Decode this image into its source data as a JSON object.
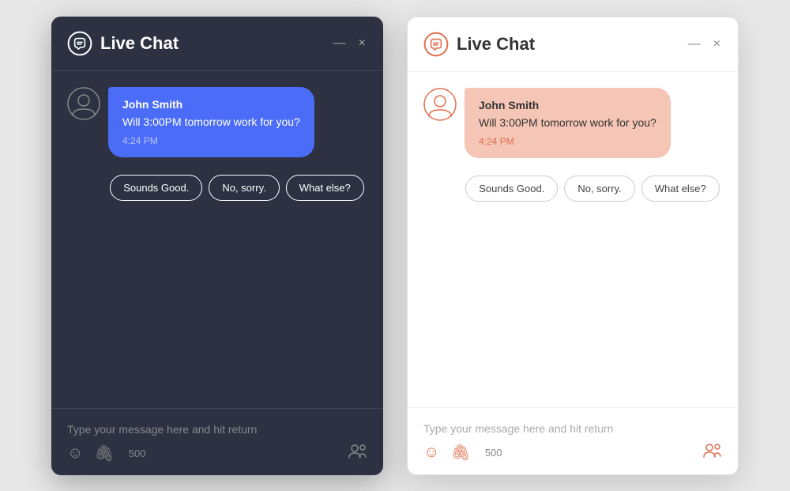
{
  "dark_widget": {
    "title": "Live Chat",
    "minimize_label": "—",
    "close_label": "×",
    "message": {
      "sender": "John Smith",
      "text": "Will 3:00PM tomorrow work for you?",
      "time": "4:24 PM"
    },
    "quick_replies": [
      "Sounds Good.",
      "No, sorry.",
      "What else?"
    ],
    "input_placeholder": "Type your message here and hit return",
    "char_count": "500"
  },
  "light_widget": {
    "title": "Live Chat",
    "minimize_label": "—",
    "close_label": "×",
    "message": {
      "sender": "John Smith",
      "text": "Will 3:00PM tomorrow work for you?",
      "time": "4:24 PM"
    },
    "quick_replies": [
      "Sounds Good.",
      "No, sorry.",
      "What else?"
    ],
    "input_placeholder": "Type your message here and hit return",
    "char_count": "500"
  },
  "colors": {
    "dark_bg": "#2d3142",
    "dark_bubble": "#4a6cf7",
    "light_bubble": "#f5c5b5",
    "accent_orange": "#e07050"
  }
}
